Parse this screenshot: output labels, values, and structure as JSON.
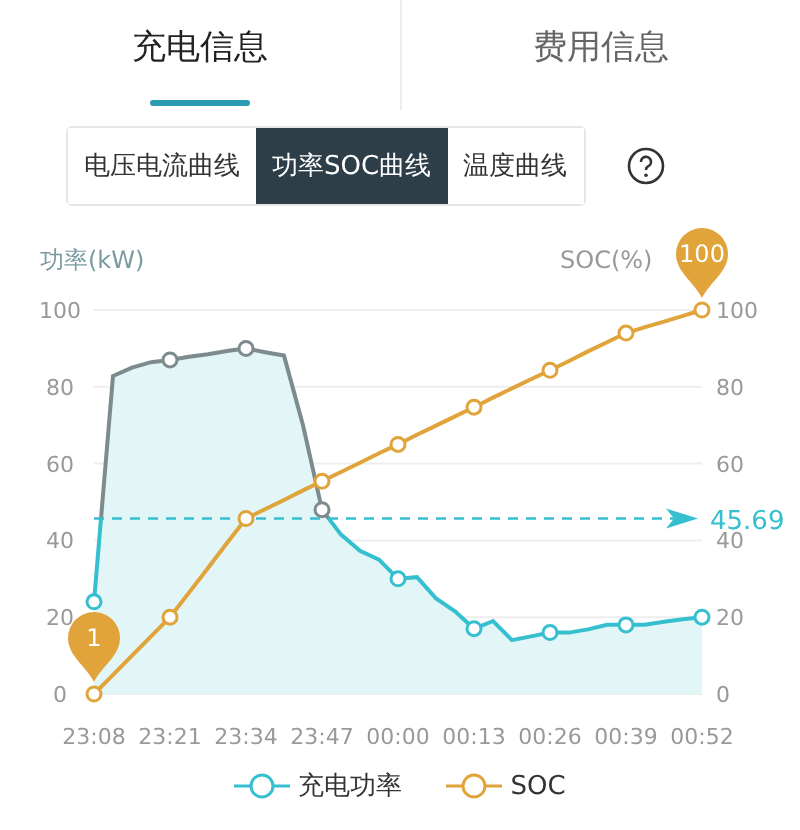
{
  "tabs": [
    {
      "label": "充电信息",
      "selected": true
    },
    {
      "label": "费用信息",
      "selected": false
    }
  ],
  "segments": [
    {
      "label": "电压电流曲线",
      "selected": false
    },
    {
      "label": "功率SOC曲线",
      "selected": true
    },
    {
      "label": "温度曲线",
      "selected": false
    }
  ],
  "chart": {
    "chart_data": {
      "type": "line",
      "grid": true,
      "ylabel": "功率(kW)",
      "y2label": "SOC(%)",
      "categories": [
        "23:08",
        null,
        null,
        null,
        "23:21",
        null,
        null,
        null,
        "23:34",
        null,
        null,
        null,
        "23:47",
        null,
        null,
        null,
        "00:00",
        null,
        null,
        null,
        "00:13",
        null,
        null,
        null,
        "00:26",
        null,
        null,
        null,
        "00:39",
        null,
        null,
        null,
        "00:52"
      ],
      "ylim": [
        0,
        100
      ],
      "yticks": [
        0,
        20,
        40,
        60,
        80,
        100
      ],
      "y2ticks": [
        0,
        20,
        40,
        60,
        80,
        100
      ],
      "y2lim": [
        0,
        100
      ],
      "series": [
        {
          "name": "充电功率",
          "type": "area",
          "color": "#35bfcf",
          "values": [
            24,
            82.8,
            85,
            86.4,
            87,
            87.8,
            88.5,
            89.3,
            90,
            89,
            88.1,
            70,
            48,
            41.5,
            37.3,
            35,
            30,
            30.4,
            24.9,
            21.5,
            17,
            19,
            14,
            15,
            16,
            16,
            16.8,
            18,
            18,
            18,
            18.8,
            19.5,
            20
          ]
        },
        {
          "name": "SOC",
          "type": "line",
          "color": "#e0a43a",
          "values": [
            0,
            5,
            10,
            15,
            20,
            26.4,
            32.8,
            39.3,
            45.7,
            48.1,
            50.5,
            53,
            55.4,
            57.8,
            60.2,
            62.7,
            65,
            67.5,
            69.9,
            72.3,
            74.7,
            77.2,
            79.6,
            82,
            84.3,
            86.7,
            89.2,
            91.6,
            94,
            95.5,
            97,
            98.5,
            100
          ]
        }
      ],
      "ref_lines": [
        {
          "axis": "y",
          "value": 45.69,
          "label": "45.69",
          "color": "#35bfcf"
        }
      ],
      "annotations": [
        {
          "x": "00:52",
          "y": 100,
          "text": "100"
        },
        {
          "x": "23:08",
          "y": 0,
          "text": "1"
        }
      ]
    }
  }
}
